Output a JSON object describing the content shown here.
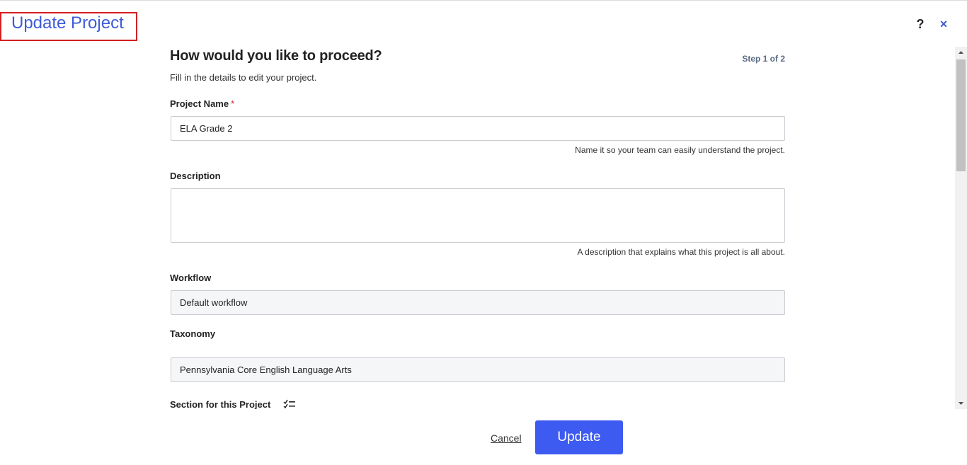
{
  "dialog": {
    "title": "Update Project",
    "help_label": "?",
    "close_label": "×"
  },
  "form": {
    "heading": "How would you like to proceed?",
    "step": "Step 1 of 2",
    "subheading": "Fill in the details to edit your project.",
    "project_name": {
      "label": "Project Name",
      "required_mark": "*",
      "value": "ELA Grade 2",
      "hint": "Name it so your team can easily understand the project."
    },
    "description": {
      "label": "Description",
      "value": "",
      "hint": "A description that explains what this project is all about."
    },
    "workflow": {
      "label": "Workflow",
      "value": "Default workflow"
    },
    "taxonomy": {
      "label": "Taxonomy",
      "value": "Pennsylvania Core English Language Arts"
    },
    "section": {
      "label": "Section for this Project",
      "icon": "checklist-icon"
    }
  },
  "footer": {
    "cancel_label": "Cancel",
    "update_label": "Update",
    "accent_color": "#3d5af1"
  }
}
